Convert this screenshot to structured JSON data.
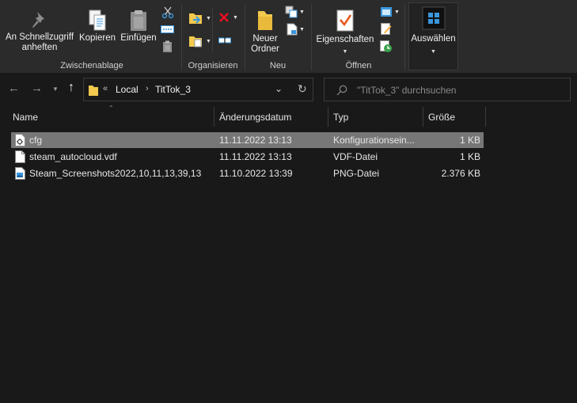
{
  "ribbon": {
    "pin_label_1": "An Schnellzugriff",
    "pin_label_2": "anheften",
    "copy_label": "Kopieren",
    "paste_label": "Einfügen",
    "clipboard_group": "Zwischenablage",
    "organize_group": "Organisieren",
    "new_folder_label_1": "Neuer",
    "new_folder_label_2": "Ordner",
    "new_group": "Neu",
    "properties_label": "Eigenschaften",
    "open_group": "Öffnen",
    "select_label": "Auswählen"
  },
  "address": {
    "overflow": "«",
    "crumbs": [
      "Local",
      "TitTok_3"
    ]
  },
  "search": {
    "placeholder": "\"TitTok_3\" durchsuchen"
  },
  "columns": {
    "name": "Name",
    "date": "Änderungsdatum",
    "type": "Typ",
    "size": "Größe"
  },
  "files": [
    {
      "name": "cfg",
      "date": "11.11.2022 13:13",
      "type": "Konfigurationsein...",
      "size": "1 KB",
      "icon": "config-file-icon",
      "selected": true
    },
    {
      "name": "steam_autocloud.vdf",
      "date": "11.11.2022 13:13",
      "type": "VDF-Datei",
      "size": "1 KB",
      "icon": "blank-file-icon",
      "selected": false
    },
    {
      "name": "Steam_Screenshots2022,10,11,13,39,13",
      "date": "11.10.2022 13:39",
      "type": "PNG-Datei",
      "size": "2.376 KB",
      "icon": "image-file-icon",
      "selected": false
    }
  ],
  "colors": {
    "background": "#191919",
    "ribbon": "#2b2b2b",
    "selection": "#777777",
    "folder": "#f3c94e",
    "accent_blue": "#3a96dd",
    "red": "#e81123"
  }
}
